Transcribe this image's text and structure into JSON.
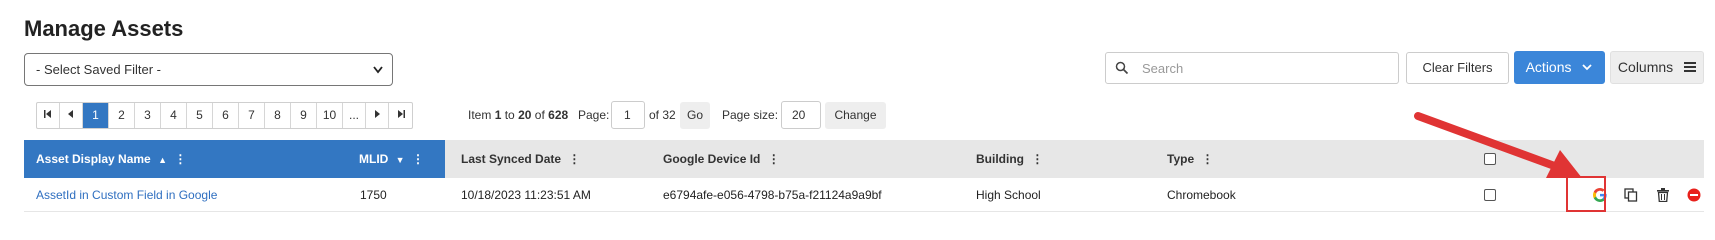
{
  "page": {
    "title": "Manage Assets"
  },
  "filter": {
    "saved_filter_value": "- Select Saved Filter -"
  },
  "search": {
    "placeholder": "Search"
  },
  "toolbar": {
    "clear_filters_label": "Clear Filters",
    "actions_label": "Actions",
    "columns_label": "Columns"
  },
  "pager": {
    "pages": [
      "1",
      "2",
      "3",
      "4",
      "5",
      "6",
      "7",
      "8",
      "9",
      "10",
      "..."
    ],
    "active_page": "1",
    "item_prefix": "Item",
    "item_start": "1",
    "item_to": "to",
    "item_end": "20",
    "item_of": "of",
    "item_total": "628",
    "page_label": "Page:",
    "page_value": "1",
    "of_pages": "of 32",
    "go_label": "Go",
    "page_size_label": "Page size:",
    "page_size_value": "20",
    "change_label": "Change"
  },
  "table": {
    "columns": [
      {
        "label": "Asset Display Name",
        "sort": "▲"
      },
      {
        "label": "MLID",
        "sort": "▼"
      },
      {
        "label": "Last Synced Date",
        "sort": ""
      },
      {
        "label": "Google Device Id",
        "sort": ""
      },
      {
        "label": "Building",
        "sort": ""
      },
      {
        "label": "Type",
        "sort": ""
      }
    ],
    "rows": [
      {
        "asset_name": "AssetId in Custom Field in Google",
        "mlid": "1750",
        "last_synced": "10/18/2023 11:23:51 AM",
        "google_device_id": "e6794afe-e056-4798-b75a-f21124a9a9bf",
        "building": "High School",
        "type": "Chromebook"
      }
    ]
  },
  "icons": {
    "row_actions": [
      "google-icon",
      "copy-icon",
      "trash-icon",
      "remove-icon"
    ]
  },
  "colors": {
    "accent": "#3377c2",
    "actions_button": "#3b86d9",
    "annotation_red": "#e03434"
  }
}
